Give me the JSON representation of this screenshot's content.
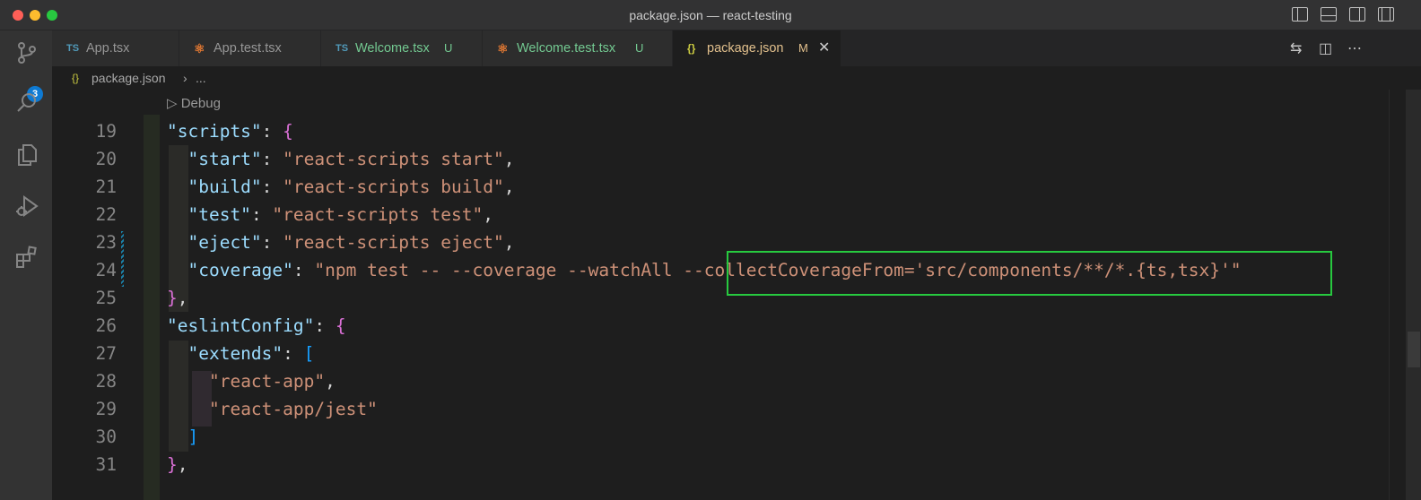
{
  "window": {
    "title": "package.json — react-testing"
  },
  "activity_bar": {
    "source_control_badge": "3",
    "icons": [
      "source-control-icon",
      "search-icon",
      "explorer-icon",
      "run-debug-icon",
      "extensions-icon"
    ]
  },
  "tabs": [
    {
      "icon_text": "TS",
      "label": "App.tsx",
      "status": ""
    },
    {
      "icon_text": "⚛",
      "label": "App.test.tsx",
      "status": ""
    },
    {
      "icon_text": "TS",
      "label": "Welcome.tsx",
      "status": "U"
    },
    {
      "icon_text": "⚛",
      "label": "Welcome.test.tsx",
      "status": "U"
    },
    {
      "icon_text": "{}",
      "label": "package.json",
      "status": "M",
      "close": "✕"
    }
  ],
  "breadcrumb": {
    "icon_text": "{}",
    "file": "package.json",
    "separator": "›",
    "more": "..."
  },
  "editor": {
    "codelens": "Debug",
    "lines": [
      {
        "n": "19",
        "indent": "",
        "key": "\"scripts\"",
        "rest": ": ",
        "bracket": "{",
        "comma": ""
      },
      {
        "n": "20",
        "indent": "  ",
        "key": "\"start\"",
        "value": "\"react-scripts start\"",
        "comma": ","
      },
      {
        "n": "21",
        "indent": "  ",
        "key": "\"build\"",
        "value": "\"react-scripts build\"",
        "comma": ","
      },
      {
        "n": "22",
        "indent": "  ",
        "key": "\"test\"",
        "value": "\"react-scripts test\"",
        "comma": ","
      },
      {
        "n": "23",
        "indent": "  ",
        "key": "\"eject\"",
        "value": "\"react-scripts eject\"",
        "comma": ","
      },
      {
        "n": "24",
        "indent": "  ",
        "key": "\"coverage\"",
        "value": "\"npm test -- --coverage --watchAll --collectCoverageFrom='src/components/**/*.{ts,tsx}'\"",
        "comma": ""
      },
      {
        "n": "25",
        "indent": "",
        "close": "}",
        "comma": ","
      },
      {
        "n": "26",
        "indent": "",
        "key": "\"eslintConfig\"",
        "rest": ": ",
        "bracket": "{",
        "comma": ""
      },
      {
        "n": "27",
        "indent": "  ",
        "key": "\"extends\"",
        "rest": ": ",
        "bracket": "[",
        "comma": ""
      },
      {
        "n": "28",
        "indent": "    ",
        "value_only": "\"react-app\"",
        "comma": ","
      },
      {
        "n": "29",
        "indent": "    ",
        "value_only": "\"react-app/jest\"",
        "comma": ""
      },
      {
        "n": "30",
        "indent": "  ",
        "close": "]",
        "comma": ""
      },
      {
        "n": "31",
        "indent": "",
        "close": "}",
        "comma": ","
      }
    ]
  },
  "colors": {
    "key": "#9cdcfe",
    "string": "#ce9178",
    "brace_level1": "#da70d6",
    "bracket_level2": "#179fff",
    "highlight_box": "#27c93f"
  }
}
